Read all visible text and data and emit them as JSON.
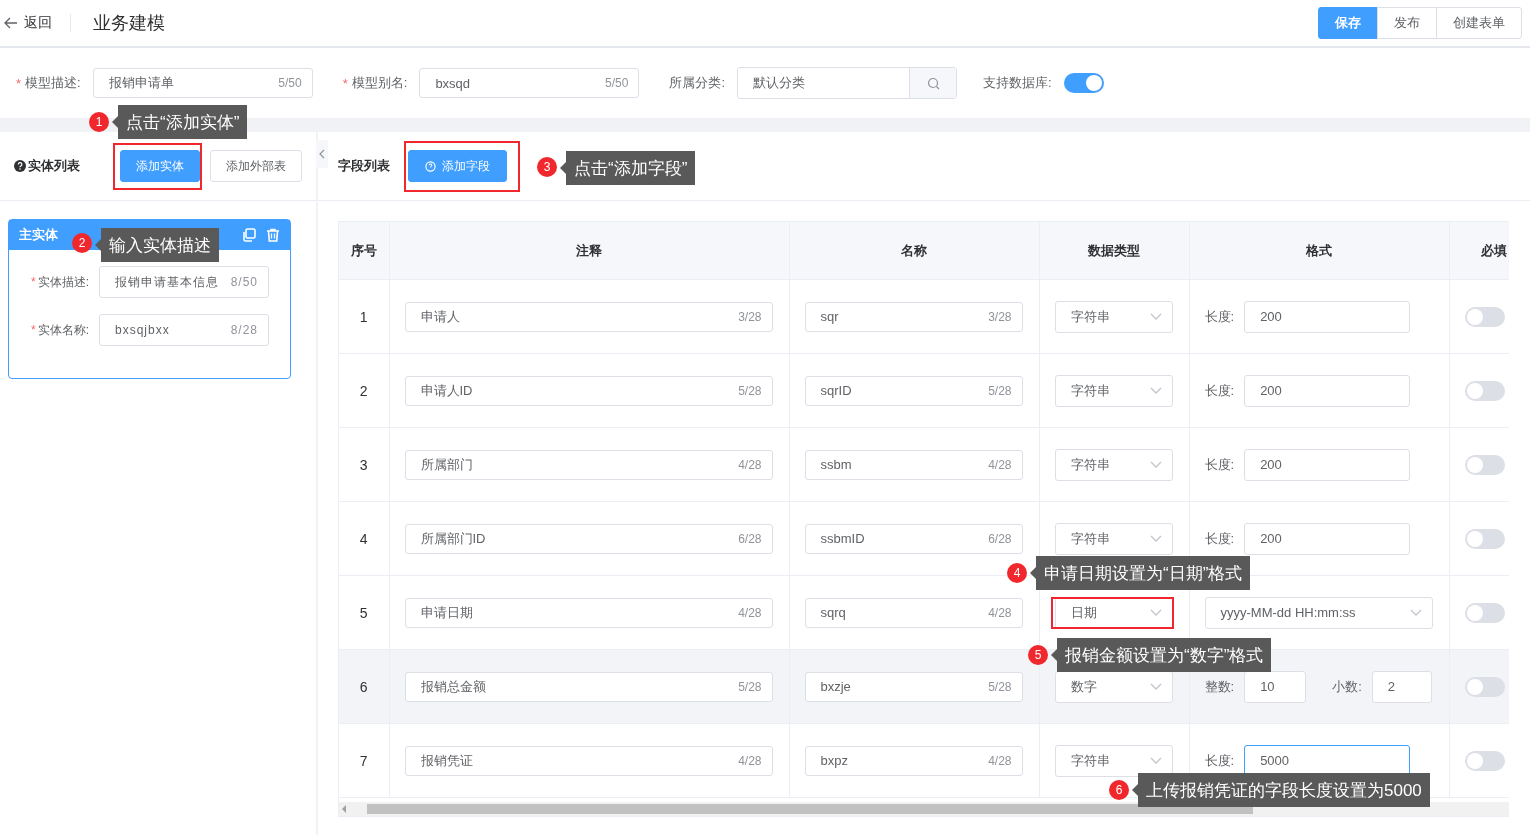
{
  "header": {
    "back": "返回",
    "title": "业务建模",
    "actions": [
      {
        "label": "保存",
        "primary": true
      },
      {
        "label": "发布",
        "primary": false
      },
      {
        "label": "创建表单",
        "primary": false
      }
    ]
  },
  "model_form": {
    "fields": [
      {
        "label": "模型描述:",
        "required_mark": "*",
        "value": "报销申请单",
        "counter": "5/50"
      },
      {
        "label": "模型别名:",
        "required_mark": "*",
        "value": "bxsqd",
        "counter": "5/50"
      }
    ],
    "category": {
      "label": "所属分类:",
      "value": "默认分类"
    },
    "db_support": {
      "label": "支持数据库:",
      "on": true
    }
  },
  "entity_panel": {
    "title": "实体列表",
    "buttons": [
      {
        "label": "添加实体",
        "primary": true
      },
      {
        "label": "添加外部表",
        "primary": false
      }
    ],
    "entity": {
      "title": "主实体",
      "fields": [
        {
          "label": "实体描述:",
          "required_mark": "*",
          "value": "报销申请基本信息",
          "counter": "8/50"
        },
        {
          "label": "实体名称:",
          "required_mark": "*",
          "value": "bxsqjbxx",
          "counter": "8/28"
        }
      ]
    }
  },
  "field_panel": {
    "title": "字段列表",
    "add_button": "添加字段",
    "columns": [
      "序号",
      "注释",
      "名称",
      "数据类型",
      "格式",
      "必填"
    ],
    "rows": [
      {
        "index": "1",
        "comment": "申请人",
        "comment_counter": "3/28",
        "name": "sqr",
        "name_counter": "3/28",
        "type": "字符串",
        "highlighted": false,
        "required": false,
        "format": {
          "kind": "length",
          "label": "长度:",
          "value": "200",
          "focused": false
        }
      },
      {
        "index": "2",
        "comment": "申请人ID",
        "comment_counter": "5/28",
        "name": "sqrID",
        "name_counter": "5/28",
        "type": "字符串",
        "highlighted": false,
        "required": false,
        "format": {
          "kind": "length",
          "label": "长度:",
          "value": "200",
          "focused": false
        }
      },
      {
        "index": "3",
        "comment": "所属部门",
        "comment_counter": "4/28",
        "name": "ssbm",
        "name_counter": "4/28",
        "type": "字符串",
        "highlighted": false,
        "required": false,
        "format": {
          "kind": "length",
          "label": "长度:",
          "value": "200",
          "focused": false
        }
      },
      {
        "index": "4",
        "comment": "所属部门ID",
        "comment_counter": "6/28",
        "name": "ssbmID",
        "name_counter": "6/28",
        "type": "字符串",
        "highlighted": false,
        "required": false,
        "format": {
          "kind": "length",
          "label": "长度:",
          "value": "200",
          "focused": false
        }
      },
      {
        "index": "5",
        "comment": "申请日期",
        "comment_counter": "4/28",
        "name": "sqrq",
        "name_counter": "4/28",
        "type": "日期",
        "highlighted": false,
        "required": false,
        "format": {
          "kind": "select",
          "value": "yyyy-MM-dd HH:mm:ss",
          "focused": false
        }
      },
      {
        "index": "6",
        "comment": "报销总金额",
        "comment_counter": "5/28",
        "name": "bxzje",
        "name_counter": "5/28",
        "type": "数字",
        "highlighted": true,
        "required": false,
        "format": {
          "kind": "number",
          "int_label": "整数:",
          "int_value": "10",
          "dec_label": "小数:",
          "dec_value": "2",
          "focused": false
        }
      },
      {
        "index": "7",
        "comment": "报销凭证",
        "comment_counter": "4/28",
        "name": "bxpz",
        "name_counter": "4/28",
        "type": "字符串",
        "highlighted": false,
        "required": false,
        "format": {
          "kind": "length",
          "label": "长度:",
          "value": "5000",
          "focused": true
        }
      }
    ]
  },
  "annotations": [
    {
      "number": "1",
      "text": "点击“添加实体”"
    },
    {
      "number": "2",
      "text": "输入实体描述"
    },
    {
      "number": "3",
      "text": "点击“添加字段”"
    },
    {
      "number": "4",
      "text": "申请日期设置为“日期”格式"
    },
    {
      "number": "5",
      "text": "报销金额设置为“数字”格式"
    },
    {
      "number": "6",
      "text": "上传报销凭证的字段长度设置为5000"
    }
  ]
}
